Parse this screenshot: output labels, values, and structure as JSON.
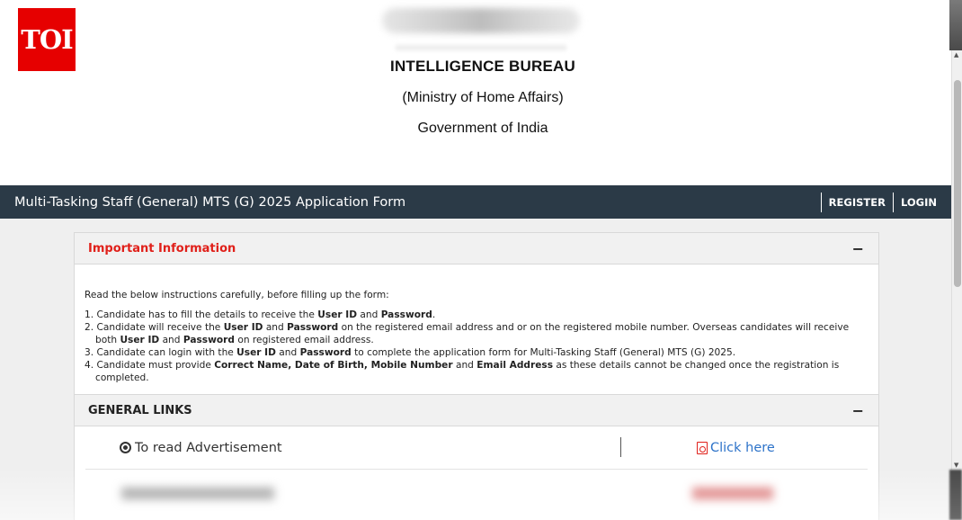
{
  "logo": {
    "text": "TOI",
    "color": "#e60000"
  },
  "org": {
    "title": "INTELLIGENCE BUREAU",
    "ministry": "(Ministry of Home Affairs)",
    "government": "Government of India"
  },
  "nav": {
    "title": "Multi-Tasking Staff (General) MTS (G) 2025 Application Form",
    "register": "REGISTER",
    "login": "LOGIN",
    "background": "#2b3a47"
  },
  "important": {
    "title": "Important Information",
    "intro": "Read the below instructions carefully, before filling up the form:",
    "items": [
      [
        "1. Candidate has to fill the details to receive the ",
        {
          "b": "User ID"
        },
        " and ",
        {
          "b": "Password"
        },
        "."
      ],
      [
        "2. Candidate will receive the ",
        {
          "b": "User ID"
        },
        " and ",
        {
          "b": "Password"
        },
        " on the registered email address and or on the registered mobile number. Overseas candidates will receive both ",
        {
          "b": "User ID"
        },
        " and ",
        {
          "b": "Password"
        },
        " on registered email address."
      ],
      [
        "3. Candidate can login with the ",
        {
          "b": "User ID"
        },
        " and ",
        {
          "b": "Password"
        },
        " to complete the application form for Multi-Tasking Staff (General) MTS (G) 2025."
      ],
      [
        "4. Candidate must provide ",
        {
          "b": "Correct Name, Date of Birth, Mobile Number"
        },
        " and ",
        {
          "b": "Email Address"
        },
        " as these details cannot be changed once the registration is completed."
      ]
    ],
    "collapse_symbol": "−"
  },
  "general_links": {
    "title": "GENERAL LINKS",
    "collapse_symbol": "−",
    "rows": [
      {
        "label": "To read Advertisement",
        "action": "Click here"
      }
    ]
  },
  "colors": {
    "accent_red": "#e0201a",
    "link_blue": "#2d73c9"
  }
}
